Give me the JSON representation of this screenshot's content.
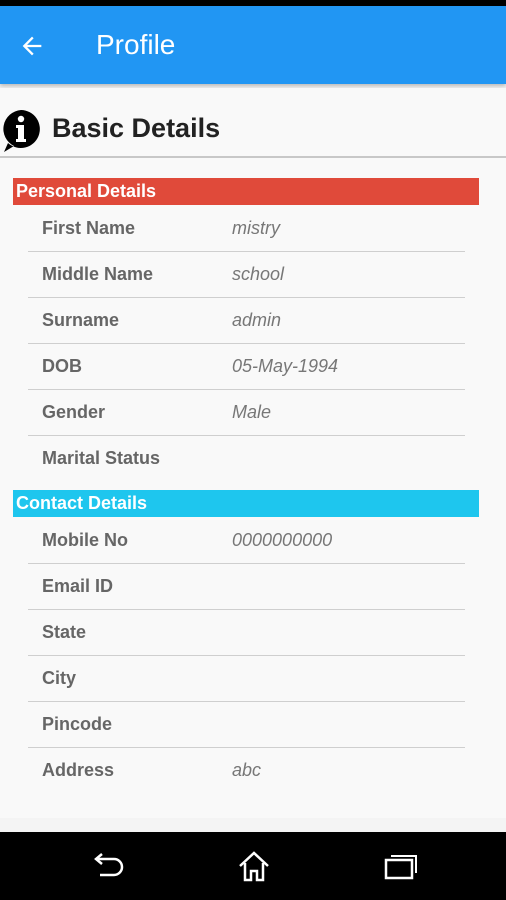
{
  "app_bar": {
    "title": "Profile",
    "color": "#2196f3",
    "back_icon": "arrow-left-icon"
  },
  "header": {
    "title": "Basic Details",
    "icon": "info-icon"
  },
  "personal": {
    "title": "Personal Details",
    "color": "#e04a3a",
    "rows": [
      {
        "label": "First Name",
        "value": "mistry"
      },
      {
        "label": "Middle Name",
        "value": "school"
      },
      {
        "label": "Surname",
        "value": "admin"
      },
      {
        "label": "DOB",
        "value": "05-May-1994"
      },
      {
        "label": "Gender",
        "value": "Male"
      },
      {
        "label": "Marital Status",
        "value": ""
      }
    ]
  },
  "contact": {
    "title": "Contact Details",
    "color": "#1ec6ee",
    "rows": [
      {
        "label": "Mobile No",
        "value": "0000000000"
      },
      {
        "label": "Email ID",
        "value": ""
      },
      {
        "label": "State",
        "value": ""
      },
      {
        "label": "City",
        "value": ""
      },
      {
        "label": "Pincode",
        "value": ""
      },
      {
        "label": "Address",
        "value": "abc"
      }
    ]
  },
  "nav_bar": {
    "icons": [
      "back-icon",
      "home-icon",
      "recents-icon"
    ]
  }
}
